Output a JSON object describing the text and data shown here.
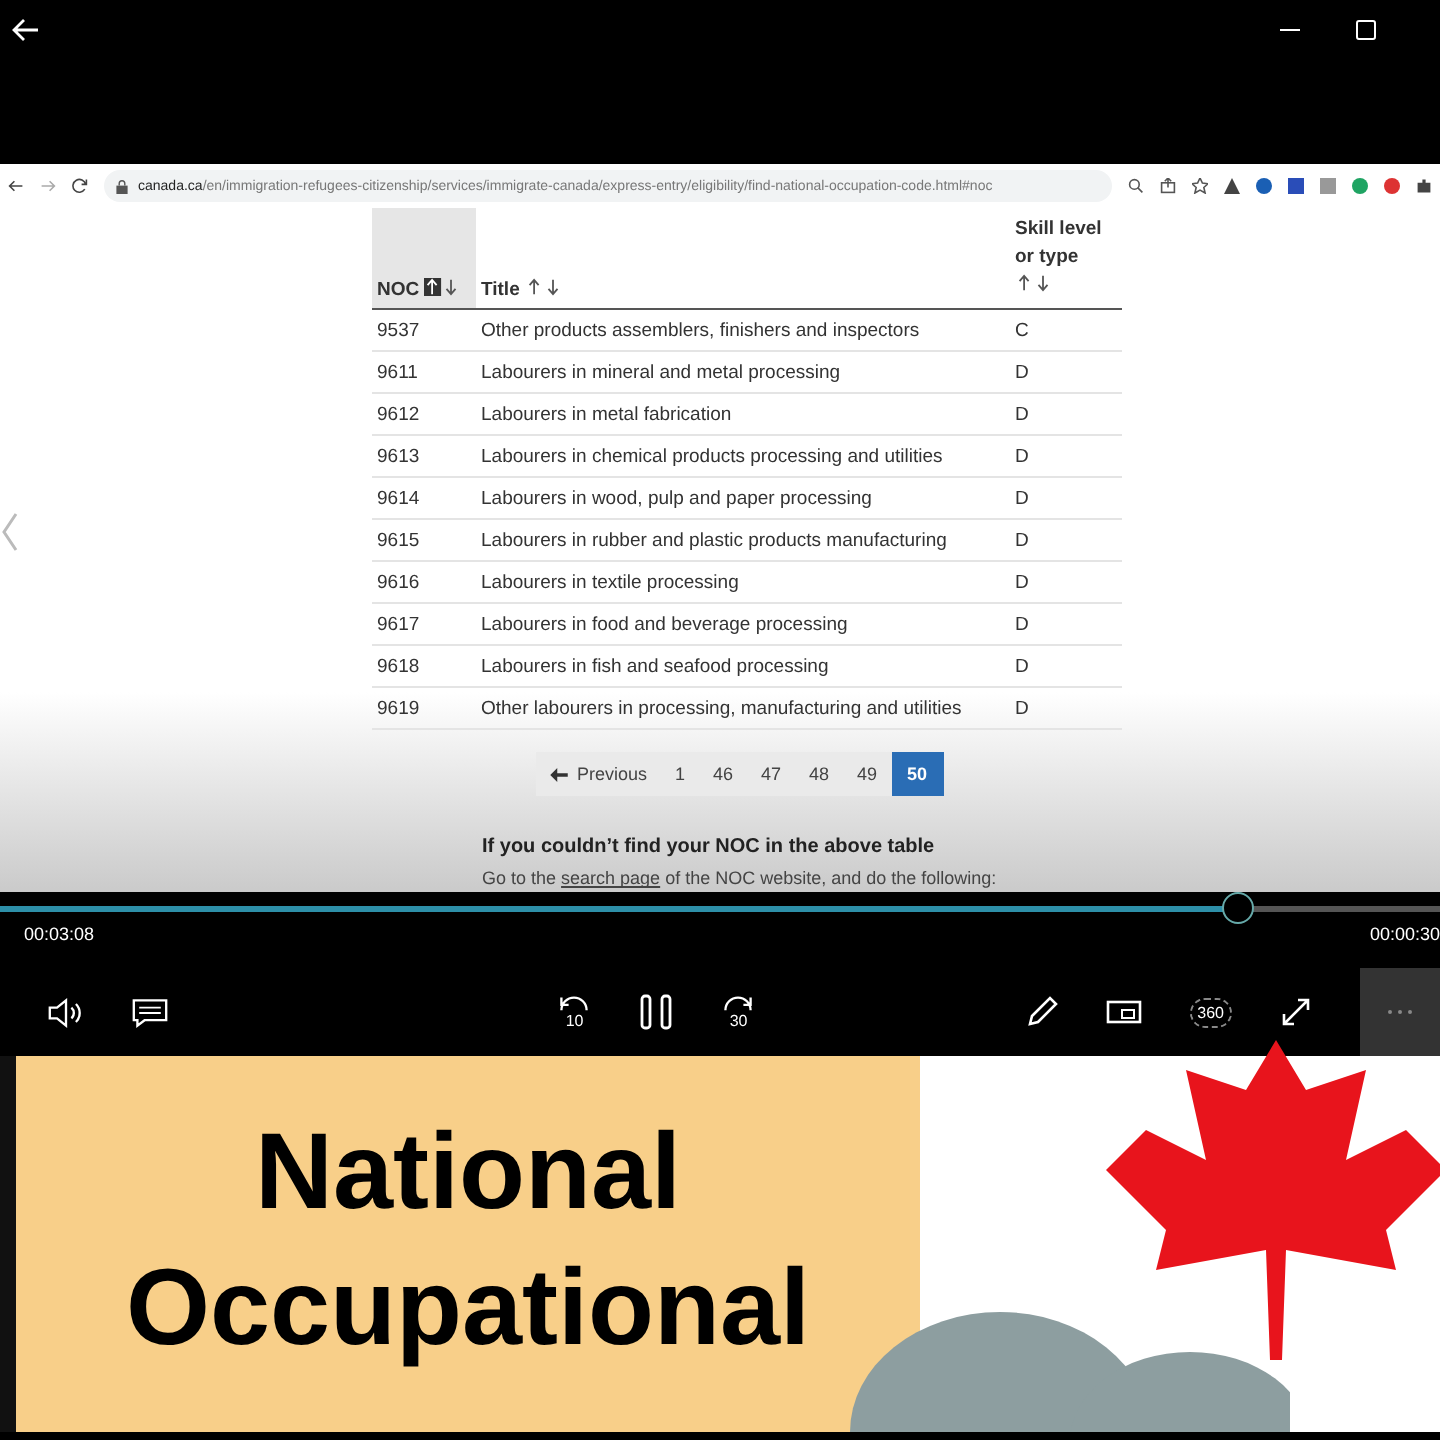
{
  "browser": {
    "url_domain": "canada.ca",
    "url_path": "/en/immigration-refugees-citizenship/services/immigrate-canada/express-entry/eligibility/find-national-occupation-code.html#noc"
  },
  "table": {
    "columns": [
      {
        "label": "NOC",
        "sorted": true
      },
      {
        "label": "Title",
        "sorted": false
      },
      {
        "label": "Skill level or type",
        "sorted": false
      }
    ],
    "rows": [
      [
        "9537",
        "Other products assemblers, finishers and inspectors",
        "C"
      ],
      [
        "9611",
        "Labourers in mineral and metal processing",
        "D"
      ],
      [
        "9612",
        "Labourers in metal fabrication",
        "D"
      ],
      [
        "9613",
        "Labourers in chemical products processing and utilities",
        "D"
      ],
      [
        "9614",
        "Labourers in wood, pulp and paper processing",
        "D"
      ],
      [
        "9615",
        "Labourers in rubber and plastic products manufacturing",
        "D"
      ],
      [
        "9616",
        "Labourers in textile processing",
        "D"
      ],
      [
        "9617",
        "Labourers in food and beverage processing",
        "D"
      ],
      [
        "9618",
        "Labourers in fish and seafood processing",
        "D"
      ],
      [
        "9619",
        "Other labourers in processing, manufacturing and utilities",
        "D"
      ]
    ]
  },
  "pagination": {
    "previous": "Previous",
    "pages": [
      {
        "label": "1",
        "selected": false
      },
      {
        "label": "46",
        "selected": false
      },
      {
        "label": "47",
        "selected": false
      },
      {
        "label": "48",
        "selected": false
      },
      {
        "label": "49",
        "selected": false
      },
      {
        "label": "50",
        "selected": true
      }
    ]
  },
  "help": {
    "heading": "If you couldn’t find your NOC in the above table",
    "text_before": "Go to the ",
    "link": "search page",
    "text_after": " of the NOC website, and do the following:"
  },
  "player": {
    "elapsed": "00:03:08",
    "remaining": "00:00:30",
    "level": 0.86,
    "playing": true,
    "skip_back": "10",
    "skip_forward": "30",
    "vr_label": "360"
  },
  "poster": {
    "lines": [
      "National",
      "Occupational"
    ]
  }
}
